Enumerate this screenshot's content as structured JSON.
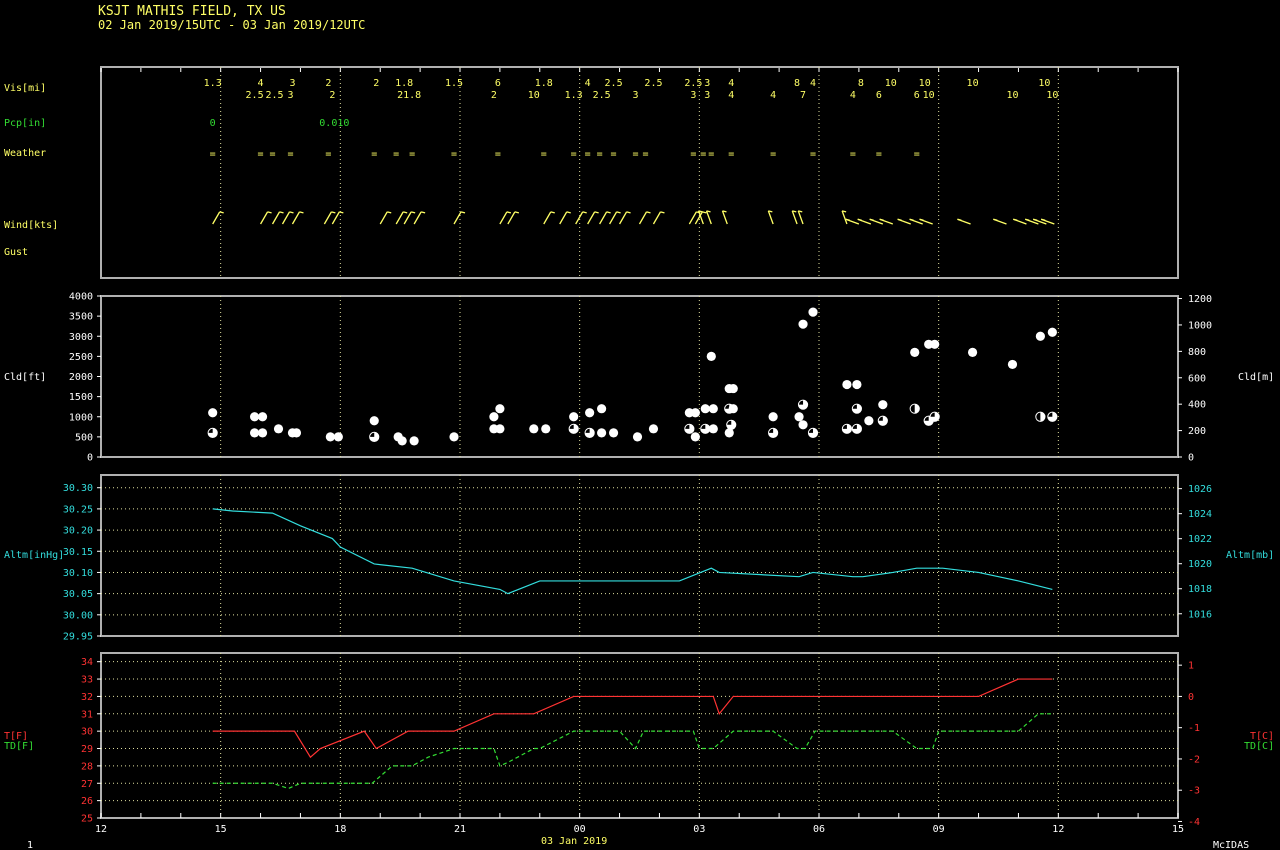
{
  "header": {
    "title": "KSJT  MATHIS FIELD, TX US",
    "period": "02 Jan 2019/15UTC - 03 Jan 2019/12UTC"
  },
  "footer": {
    "date": "03 Jan 2019",
    "page": "1",
    "brand": "McIDAS"
  },
  "colors": {
    "yellow": "#ffff66",
    "white": "#ffffff",
    "cyan": "#33dddd",
    "red": "#ff3333",
    "green": "#33dd33",
    "frame": "#b0b0b0"
  },
  "labels": {
    "vis": "Vis[mi]",
    "pcp": "Pcp[in]",
    "weather": "Weather",
    "wind": "Wind[kts]",
    "gust": "Gust",
    "cld_left": "Cld[ft]",
    "cld_right": "Cld[m]",
    "altm_left": "Altm[inHg]",
    "altm_right": "Altm[mb]",
    "t_left": "T[F]",
    "td_left": "TD[F]",
    "t_right": "T[C]",
    "td_right": "TD[C]"
  },
  "chart_data": {
    "type": "line",
    "x_axis": {
      "range_hours": [
        -3,
        24
      ],
      "tick_labels": [
        "12",
        "15",
        "18",
        "21",
        "00",
        "03",
        "06",
        "09",
        "12",
        "15"
      ],
      "label": "03 Jan 2019",
      "grid_labels": [
        "15",
        "18",
        "21",
        "00",
        "03",
        "06",
        "09",
        "12"
      ]
    },
    "vis": {
      "unit": "mi",
      "top": [
        [
          -0.2,
          "1.3"
        ],
        [
          1.0,
          "4"
        ],
        [
          1.8,
          "3"
        ],
        [
          2.7,
          "2"
        ],
        [
          3.9,
          "2"
        ],
        [
          4.6,
          "1.8"
        ],
        [
          5.85,
          "1.5"
        ],
        [
          6.95,
          "6"
        ],
        [
          8.1,
          "1.8"
        ],
        [
          9.2,
          "4"
        ],
        [
          9.85,
          "2.5"
        ],
        [
          10.85,
          "2.5"
        ],
        [
          11.85,
          "2.5"
        ],
        [
          12.2,
          "3"
        ],
        [
          12.8,
          "4"
        ],
        [
          14.45,
          "8"
        ],
        [
          14.85,
          "4"
        ],
        [
          16.05,
          "8"
        ],
        [
          16.8,
          "10"
        ],
        [
          17.65,
          "10"
        ],
        [
          18.85,
          "10"
        ],
        [
          20.65,
          "10"
        ]
      ],
      "bottom": [
        [
          0.85,
          "2.5"
        ],
        [
          1.35,
          "2.5"
        ],
        [
          1.75,
          "3"
        ],
        [
          2.8,
          "2"
        ],
        [
          4.5,
          "2"
        ],
        [
          4.8,
          "1.8"
        ],
        [
          6.85,
          "2"
        ],
        [
          7.85,
          "10"
        ],
        [
          8.85,
          "1.3"
        ],
        [
          9.55,
          "2.5"
        ],
        [
          10.4,
          "3"
        ],
        [
          11.85,
          "3"
        ],
        [
          12.2,
          "3"
        ],
        [
          12.8,
          "4"
        ],
        [
          13.85,
          "4"
        ],
        [
          14.6,
          "7"
        ],
        [
          15.85,
          "4"
        ],
        [
          16.5,
          "6"
        ],
        [
          17.45,
          "6"
        ],
        [
          17.75,
          "10"
        ],
        [
          19.85,
          "10"
        ],
        [
          20.85,
          "10"
        ]
      ]
    },
    "pcp": {
      "unit": "in",
      "values": [
        [
          -0.2,
          "0"
        ],
        [
          2.85,
          "0.010"
        ]
      ]
    },
    "weather": {
      "symbol": "=",
      "times": [
        -0.2,
        1.0,
        1.3,
        1.75,
        2.7,
        3.85,
        4.4,
        4.8,
        5.85,
        6.95,
        8.1,
        8.85,
        9.2,
        9.5,
        9.85,
        10.4,
        10.65,
        11.85,
        12.1,
        12.3,
        12.8,
        13.85,
        14.85,
        15.85,
        16.5,
        17.45
      ]
    },
    "wind": {
      "unit": "kts",
      "times": [
        -0.2,
        1.0,
        1.3,
        1.55,
        1.8,
        2.6,
        2.8,
        4.0,
        4.4,
        4.6,
        4.85,
        5.85,
        7.0,
        7.2,
        8.1,
        8.5,
        8.9,
        9.2,
        9.5,
        9.75,
        10.0,
        10.5,
        10.85,
        11.75,
        11.9,
        12.1,
        12.3,
        12.7,
        13.85,
        14.45,
        14.6,
        15.7,
        16.0,
        16.3,
        16.6,
        16.85,
        17.3,
        17.6,
        17.85,
        18.8,
        19.7,
        20.2,
        20.5,
        20.7,
        20.9
      ]
    },
    "cloud": {
      "unit_left": "ft",
      "unit_right": "m",
      "left_ticks": [
        0,
        500,
        1000,
        1500,
        2000,
        2500,
        3000,
        3500,
        4000
      ],
      "right_ticks": [
        0,
        200,
        400,
        600,
        800,
        1000,
        1200
      ],
      "ylim": [
        0,
        4000
      ],
      "observations": [
        [
          -0.2,
          1100,
          4
        ],
        [
          -0.2,
          600,
          3
        ],
        [
          0.85,
          1000,
          4
        ],
        [
          1.05,
          1000,
          4
        ],
        [
          0.85,
          600,
          4
        ],
        [
          1.05,
          600,
          4
        ],
        [
          1.45,
          700,
          4
        ],
        [
          1.8,
          600,
          4
        ],
        [
          1.9,
          600,
          4
        ],
        [
          2.75,
          500,
          4
        ],
        [
          2.95,
          500,
          4
        ],
        [
          3.85,
          900,
          4
        ],
        [
          3.85,
          500,
          3
        ],
        [
          4.45,
          500,
          4
        ],
        [
          4.55,
          400,
          4
        ],
        [
          4.85,
          400,
          4
        ],
        [
          5.85,
          500,
          4
        ],
        [
          6.85,
          1000,
          4
        ],
        [
          7.0,
          1200,
          4
        ],
        [
          6.85,
          700,
          4
        ],
        [
          7.0,
          700,
          4
        ],
        [
          7.85,
          700,
          4
        ],
        [
          8.15,
          700,
          4
        ],
        [
          8.85,
          1000,
          4
        ],
        [
          8.85,
          700,
          3
        ],
        [
          9.25,
          1100,
          4
        ],
        [
          9.25,
          600,
          3
        ],
        [
          9.55,
          1200,
          4
        ],
        [
          9.55,
          600,
          4
        ],
        [
          9.85,
          600,
          4
        ],
        [
          10.45,
          500,
          4
        ],
        [
          10.85,
          700,
          4
        ],
        [
          11.75,
          1100,
          4
        ],
        [
          11.9,
          1100,
          4
        ],
        [
          11.75,
          700,
          3
        ],
        [
          11.9,
          500,
          4
        ],
        [
          12.15,
          1200,
          4
        ],
        [
          12.35,
          1200,
          4
        ],
        [
          12.15,
          700,
          3
        ],
        [
          12.35,
          700,
          4
        ],
        [
          12.3,
          2500,
          4
        ],
        [
          12.75,
          1700,
          4
        ],
        [
          12.85,
          1700,
          4
        ],
        [
          12.75,
          1200,
          3
        ],
        [
          12.85,
          1200,
          4
        ],
        [
          12.8,
          800,
          3
        ],
        [
          12.75,
          600,
          4
        ],
        [
          13.85,
          1000,
          4
        ],
        [
          13.85,
          600,
          3
        ],
        [
          14.5,
          1000,
          4
        ],
        [
          14.6,
          3300,
          4
        ],
        [
          14.6,
          1300,
          3
        ],
        [
          14.6,
          800,
          4
        ],
        [
          14.85,
          3600,
          4
        ],
        [
          14.85,
          600,
          3
        ],
        [
          15.7,
          1800,
          4
        ],
        [
          15.95,
          1800,
          4
        ],
        [
          15.7,
          700,
          3
        ],
        [
          15.95,
          1200,
          3
        ],
        [
          15.95,
          700,
          3
        ],
        [
          16.25,
          900,
          4
        ],
        [
          16.6,
          1300,
          4
        ],
        [
          16.6,
          900,
          3
        ],
        [
          17.4,
          2600,
          4
        ],
        [
          17.75,
          2800,
          4
        ],
        [
          17.9,
          2800,
          4
        ],
        [
          17.4,
          1200,
          2
        ],
        [
          17.75,
          900,
          3
        ],
        [
          17.9,
          1000,
          3
        ],
        [
          18.85,
          2600,
          4
        ],
        [
          19.85,
          2300,
          4
        ],
        [
          20.55,
          3000,
          4
        ],
        [
          20.55,
          1000,
          2
        ],
        [
          20.85,
          3100,
          4
        ],
        [
          20.85,
          1000,
          3
        ]
      ]
    },
    "altimeter": {
      "unit_left": "inHg",
      "unit_right": "mb",
      "left_ticks": [
        "29.95",
        "30.00",
        "30.05",
        "30.10",
        "30.15",
        "30.20",
        "30.25",
        "30.30"
      ],
      "right_ticks": [
        "1016",
        "1018",
        "1020",
        "1022",
        "1024",
        "1026"
      ],
      "ylim": [
        29.95,
        30.33
      ],
      "x": [
        -0.2,
        0.3,
        1.3,
        2.0,
        2.8,
        3.0,
        3.85,
        4.8,
        5.85,
        7.0,
        7.2,
        8.0,
        9.0,
        10.0,
        11.5,
        12.3,
        12.5,
        14.5,
        14.85,
        15.85,
        16.1,
        16.85,
        17.45,
        18.1,
        19.0,
        20.0,
        20.85
      ],
      "y": [
        30.25,
        30.245,
        30.24,
        30.21,
        30.18,
        30.16,
        30.12,
        30.11,
        30.08,
        30.06,
        30.05,
        30.08,
        30.08,
        30.08,
        30.08,
        30.11,
        30.1,
        30.09,
        30.1,
        30.09,
        30.09,
        30.1,
        30.11,
        30.11,
        30.1,
        30.08,
        30.06
      ]
    },
    "temperature": {
      "left_ticks": [
        "25",
        "26",
        "27",
        "28",
        "29",
        "30",
        "31",
        "32",
        "33",
        "34"
      ],
      "right_ticks": [
        "-4",
        "-3",
        "-2",
        "-1",
        "0",
        "1"
      ],
      "ylim": [
        25,
        34.5
      ],
      "series": [
        {
          "name": "T[F]",
          "color": "#ff3333",
          "dash": false,
          "x": [
            -0.2,
            1.85,
            2.25,
            2.5,
            3.6,
            3.9,
            4.7,
            5.85,
            6.85,
            7.2,
            7.85,
            8.85,
            10.0,
            11.85,
            12.35,
            12.5,
            12.85,
            13.85,
            14.85,
            15.85,
            16.85,
            17.85,
            18.85,
            19.0,
            20.0,
            20.85
          ],
          "y": [
            30,
            30,
            28.5,
            29,
            30,
            29,
            30,
            30,
            31,
            31,
            31,
            32,
            32,
            32,
            32,
            31,
            32,
            32,
            32,
            32,
            32,
            32,
            32,
            32,
            33,
            33
          ]
        },
        {
          "name": "TD[F]",
          "color": "#33dd33",
          "dash": true,
          "x": [
            -0.2,
            1.3,
            1.7,
            2.0,
            3.0,
            3.8,
            4.3,
            4.8,
            5.2,
            5.85,
            6.85,
            7.0,
            7.2,
            7.85,
            8.0,
            8.85,
            9.0,
            10.0,
            10.4,
            10.6,
            10.85,
            11.85,
            12.0,
            12.35,
            12.85,
            13.85,
            14.45,
            14.65,
            14.9,
            15.85,
            16.85,
            17.45,
            17.85,
            18.0,
            19.0,
            20.0,
            20.5,
            20.85
          ],
          "y": [
            27,
            27,
            26.7,
            27,
            27,
            27,
            28,
            28,
            28.5,
            29,
            29,
            28,
            28.2,
            29,
            29,
            30,
            30,
            30,
            29,
            30,
            30,
            30,
            29,
            29,
            30,
            30,
            29,
            29,
            30,
            30,
            30,
            29,
            29,
            30,
            30,
            30,
            31,
            31
          ]
        }
      ]
    }
  }
}
